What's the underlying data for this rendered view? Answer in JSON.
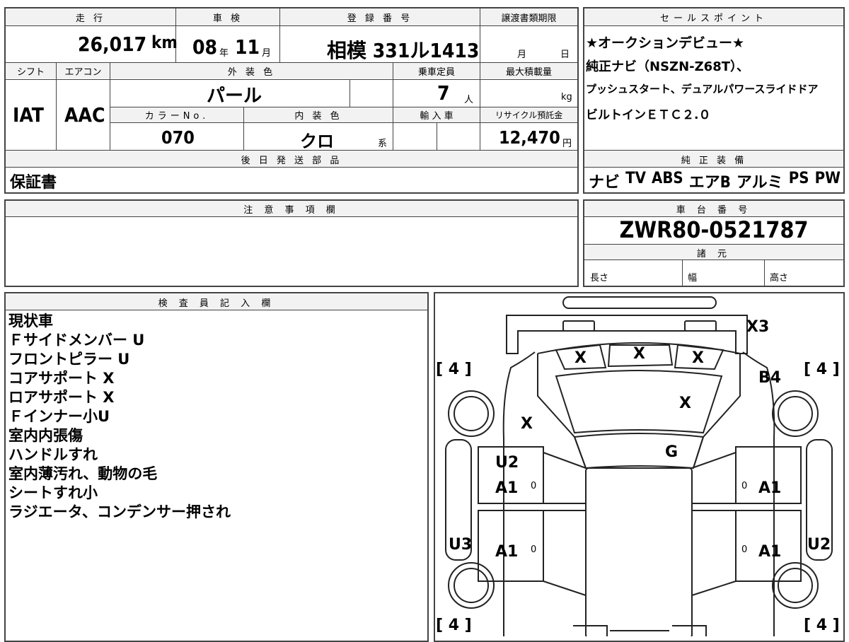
{
  "headers": {
    "mileage": "走 行",
    "inspection": "車 検",
    "registration": "登 録 番 号",
    "transfer_deadline": "譲渡書類期限",
    "sales_point": "セールスポイント",
    "shift": "シフト",
    "aircon": "エアコン",
    "exterior_color": "外 装 色",
    "capacity": "乗車定員",
    "max_load": "最大積載量",
    "color_no": "カラーNo.",
    "interior_color": "内 装 色",
    "import": "輸 入 車",
    "recycle": "リサイクル預託金",
    "later_parts": "後 日 発 送 部 品",
    "std_equipment": "純 正 装 備",
    "notes": "注 意 事 項 欄",
    "chassis_no": "車 台 番 号",
    "specs": "諸 元",
    "inspector": "検 査 員 記 入 欄"
  },
  "vehicle": {
    "mileage": "26,017",
    "mileage_unit": "km",
    "inspection_year": "08",
    "inspection_year_unit": "年",
    "inspection_month": "11",
    "inspection_month_unit": "月",
    "registration": "相模 331ル1413",
    "deadline_month_unit": "月",
    "deadline_day_unit": "日",
    "shift": "IAT",
    "aircon": "AAC",
    "exterior_color": "パール",
    "capacity": "7",
    "capacity_unit": "人",
    "max_load_unit": "kg",
    "color_no": "070",
    "interior_color": "クロ",
    "interior_suffix": "系",
    "recycle_fee": "12,470",
    "recycle_unit": "円",
    "later_parts": "保証書",
    "chassis_no": "ZWR80-0521787",
    "spec_length": "長さ",
    "spec_width": "幅",
    "spec_height": "高さ"
  },
  "sales_points": [
    "★オークションデビュー★",
    "純正ナビ（NSZN-Z68T）、",
    "プッシュスタート、デュアルパワースライドドア",
    "ビルトインＥＴＣ２.０"
  ],
  "equipment": [
    "ナビ",
    "TV",
    "ABS",
    "エアB",
    "アルミ",
    "PS",
    "PW"
  ],
  "inspector_notes": [
    "現状車",
    "Ｆサイドメンバー U",
    "フロントピラー U",
    "コアサポート X",
    "ロアサポート X",
    "Ｆインナー小U",
    "室内内張傷",
    "ハンドルすれ",
    "室内薄汚れ、動物の毛",
    "シートすれ小",
    "ラジエータ、コンデンサー押され"
  ],
  "diagram_marks": {
    "front_bumper": "X3",
    "grille_left": "X",
    "grille_center": "X",
    "grille_right": "X",
    "hood": "X",
    "front_left_fender": "X",
    "front_right_fender": "B4",
    "windshield": "G",
    "front_left_door_u": "U2",
    "front_left_door_a": "A1",
    "front_right_door_a": "A1",
    "rear_left_door_a": "A1",
    "rear_right_door_a": "A1",
    "left_sill": "U3",
    "right_sill": "U2",
    "tire_fl": "[ 4 ]",
    "tire_fr": "[ 4 ]",
    "tire_rl": "[ 4 ]",
    "tire_rr": "[ 4 ]",
    "zero": "0"
  }
}
